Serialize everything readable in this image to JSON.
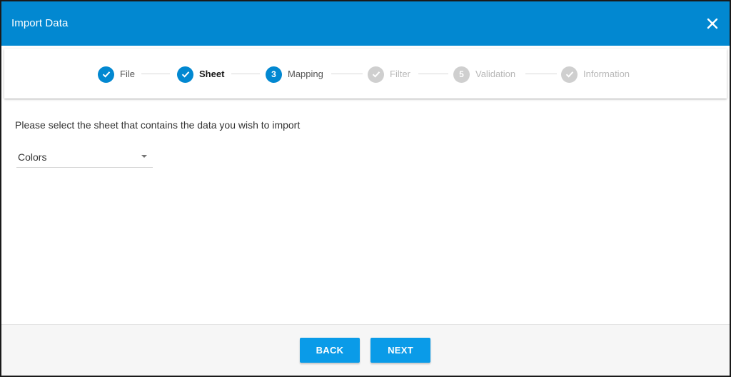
{
  "dialog": {
    "title": "Import Data",
    "close_icon": "close-icon",
    "accent_color": "#0288d1"
  },
  "stepper": {
    "steps": [
      {
        "label": "File",
        "state": "completed",
        "marker": "check-icon"
      },
      {
        "label": "Sheet",
        "state": "completed-current",
        "marker": "check-icon"
      },
      {
        "label": "Mapping",
        "state": "active",
        "marker": "3"
      },
      {
        "label": "Filter",
        "state": "disabled",
        "marker": "check-icon"
      },
      {
        "label": "Validation",
        "state": "disabled",
        "marker": "5"
      },
      {
        "label": "Information",
        "state": "disabled",
        "marker": "check-icon"
      }
    ]
  },
  "content": {
    "instruction": "Please select the sheet that contains the data you wish to import",
    "sheet_select": {
      "value": "Colors"
    }
  },
  "footer": {
    "back_label": "BACK",
    "next_label": "NEXT",
    "button_color": "#0a9be8"
  }
}
